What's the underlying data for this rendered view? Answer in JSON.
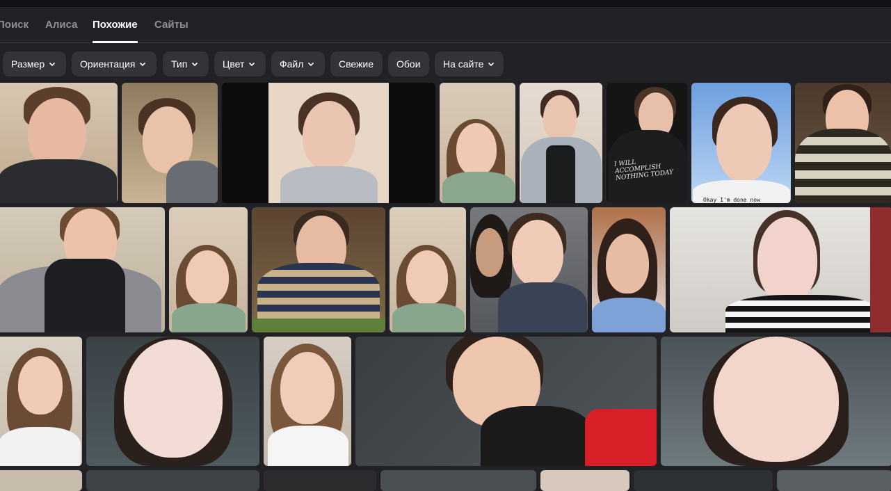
{
  "tabs": [
    {
      "label": "Поиск",
      "active": false
    },
    {
      "label": "Алиса",
      "active": false
    },
    {
      "label": "Похожие",
      "active": true
    },
    {
      "label": "Сайты",
      "active": false
    }
  ],
  "filters": [
    {
      "label": "Размер",
      "dropdown": true
    },
    {
      "label": "Ориентация",
      "dropdown": true
    },
    {
      "label": "Тип",
      "dropdown": true
    },
    {
      "label": "Цвет",
      "dropdown": true
    },
    {
      "label": "Файл",
      "dropdown": true
    },
    {
      "label": "Свежие",
      "dropdown": false
    },
    {
      "label": "Обои",
      "dropdown": false
    },
    {
      "label": "На сайте",
      "dropdown": true
    }
  ],
  "images": {
    "shirt_print": "I WILL ACCOMPLISH NOTHING TODAY",
    "caption_text": "Okay I'm done now"
  },
  "colors": {
    "background": "#222226",
    "chip": "#333338",
    "tab_inactive": "#8f8f96",
    "tab_active": "#ffffff"
  }
}
